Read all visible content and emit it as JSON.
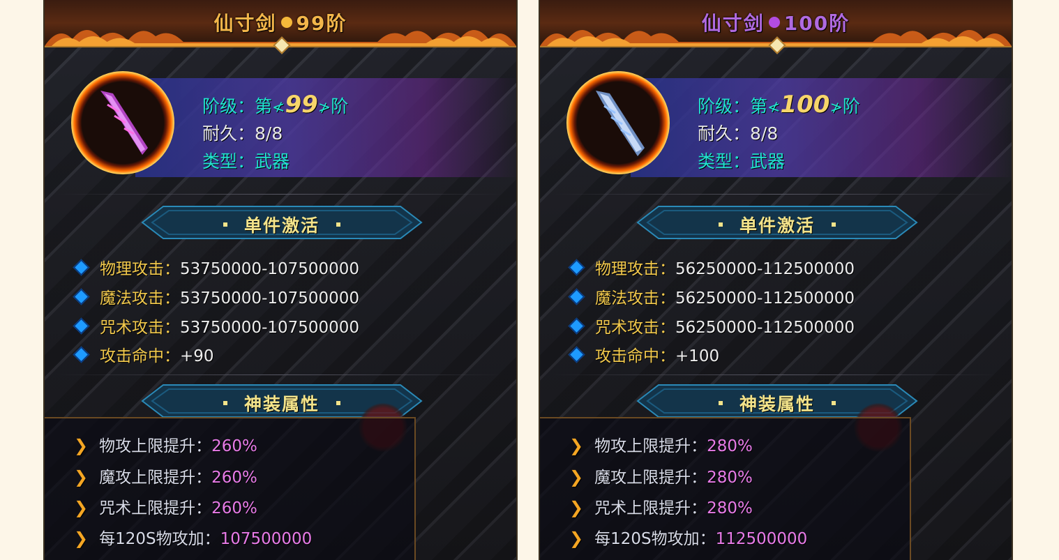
{
  "panels": [
    {
      "title_name": "仙寸剑",
      "title_tier": "99阶",
      "title_color": "#f3b64a",
      "dot_color": "#f5b83a",
      "weapon_color": "#c24ad8",
      "info": {
        "tier_key": "阶级：第",
        "tier_value": "99",
        "tier_suffix": "阶",
        "durability_key": "耐久：",
        "durability_value": "8/8",
        "type_key": "类型：",
        "type_value": "武器"
      },
      "section1_label": "单件激活",
      "stats": [
        {
          "key": "物理攻击：",
          "value": "53750000-107500000"
        },
        {
          "key": "魔法攻击：",
          "value": "53750000-107500000"
        },
        {
          "key": "咒术攻击：",
          "value": "53750000-107500000"
        },
        {
          "key": "攻击命中：",
          "value": "+90"
        }
      ],
      "section2_label": "神装属性",
      "bonuses": [
        {
          "key": "物攻上限提升：",
          "value": "260%"
        },
        {
          "key": "魔攻上限提升：",
          "value": "260%"
        },
        {
          "key": "咒术上限提升：",
          "value": "260%"
        },
        {
          "key": "每120S物攻加：",
          "value": "107500000"
        }
      ]
    },
    {
      "title_name": "仙寸剑",
      "title_tier": "100阶",
      "title_color": "#b06ae0",
      "dot_color": "#b24ce0",
      "weapon_color": "#7a9ed8",
      "info": {
        "tier_key": "阶级：第",
        "tier_value": "100",
        "tier_suffix": "阶",
        "durability_key": "耐久：",
        "durability_value": "8/8",
        "type_key": "类型：",
        "type_value": "武器"
      },
      "section1_label": "单件激活",
      "stats": [
        {
          "key": "物理攻击：",
          "value": "56250000-112500000"
        },
        {
          "key": "魔法攻击：",
          "value": "56250000-112500000"
        },
        {
          "key": "咒术攻击：",
          "value": "56250000-112500000"
        },
        {
          "key": "攻击命中：",
          "value": "+100"
        }
      ],
      "section2_label": "神装属性",
      "bonuses": [
        {
          "key": "物攻上限提升：",
          "value": "280%"
        },
        {
          "key": "魔攻上限提升：",
          "value": "280%"
        },
        {
          "key": "咒术上限提升：",
          "value": "280%"
        },
        {
          "key": "每120S物攻加：",
          "value": "112500000"
        }
      ]
    }
  ]
}
